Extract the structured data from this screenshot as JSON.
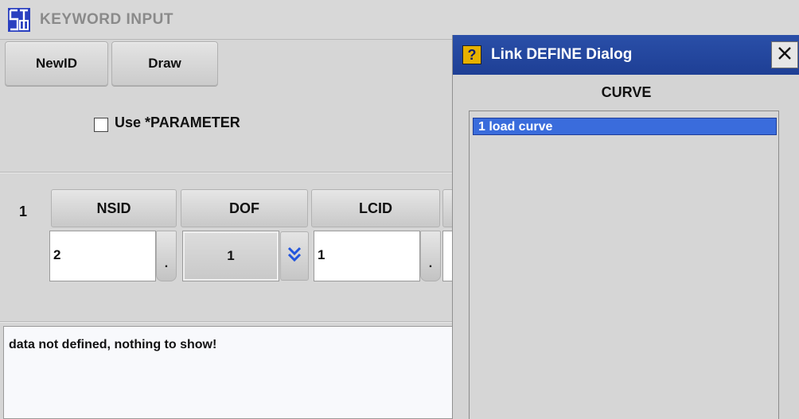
{
  "keyword_window": {
    "title": "KEYWORD INPUT",
    "logo_icon": "lstc-logo-icon",
    "toolbar": {
      "newid_label": "NewID",
      "draw_label": "Draw"
    },
    "use_parameter": {
      "label": "Use *PARAMETER",
      "checked": false
    },
    "card": {
      "row_number": "1",
      "columns": [
        {
          "header": "NSID",
          "value": "2",
          "button": "."
        },
        {
          "header": "DOF",
          "value": "1",
          "dropdown_icon": "double-chevron-down-icon"
        },
        {
          "header": "LCID",
          "value": "1",
          "button": "."
        }
      ]
    },
    "message": "data not defined, nothing to show!"
  },
  "dialog": {
    "title": "Link DEFINE Dialog",
    "help_icon": "help-icon",
    "help_glyph": "?",
    "close_icon": "close-icon",
    "list_title": "CURVE",
    "items": [
      {
        "text": "1  load curve",
        "selected": true
      }
    ]
  },
  "colors": {
    "dialog_title_bar": "#1e3f95",
    "selection": "#3a6cdc",
    "dropdown_arrow": "#2255dd",
    "title_text": "#8a8a8a"
  }
}
